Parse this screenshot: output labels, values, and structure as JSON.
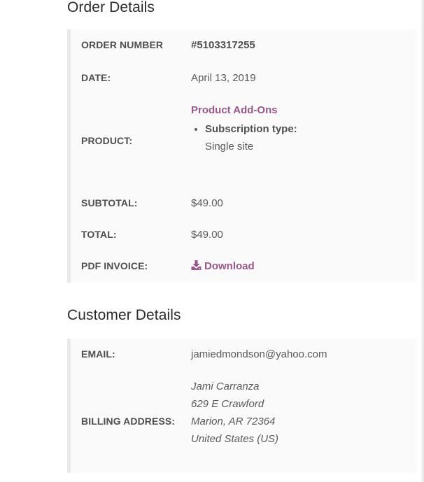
{
  "order_details": {
    "title": "Order Details",
    "order_number": {
      "label": "ORDER NUMBER",
      "value": "#5103317255"
    },
    "date": {
      "label": "DATE:",
      "value": "April 13, 2019"
    },
    "product": {
      "label": "PRODUCT:",
      "name": "Product Add-Ons",
      "meta": [
        {
          "key": "Subscription type:",
          "value": "Single site"
        }
      ]
    },
    "subtotal": {
      "label": "SUBTOTAL:",
      "value": "$49.00"
    },
    "total": {
      "label": "TOTAL:",
      "value": "$49.00"
    },
    "pdf_invoice": {
      "label": "PDF INVOICE:",
      "link_text": "Download",
      "icon": "download-icon"
    }
  },
  "customer_details": {
    "title": "Customer Details",
    "email": {
      "label": "EMAIL:",
      "value": "jamiedmondson@yahoo.com"
    },
    "billing_address": {
      "label": "BILLING ADDRESS:",
      "lines": [
        "Jami Carranza",
        "629 E Crawford",
        "Marion, AR 72364",
        "United States (US)"
      ]
    }
  },
  "colors": {
    "link": "#96588a",
    "panel_background": "#fafafa",
    "panel_border": "#e9e9e9",
    "heading": "#2b2b2b"
  }
}
